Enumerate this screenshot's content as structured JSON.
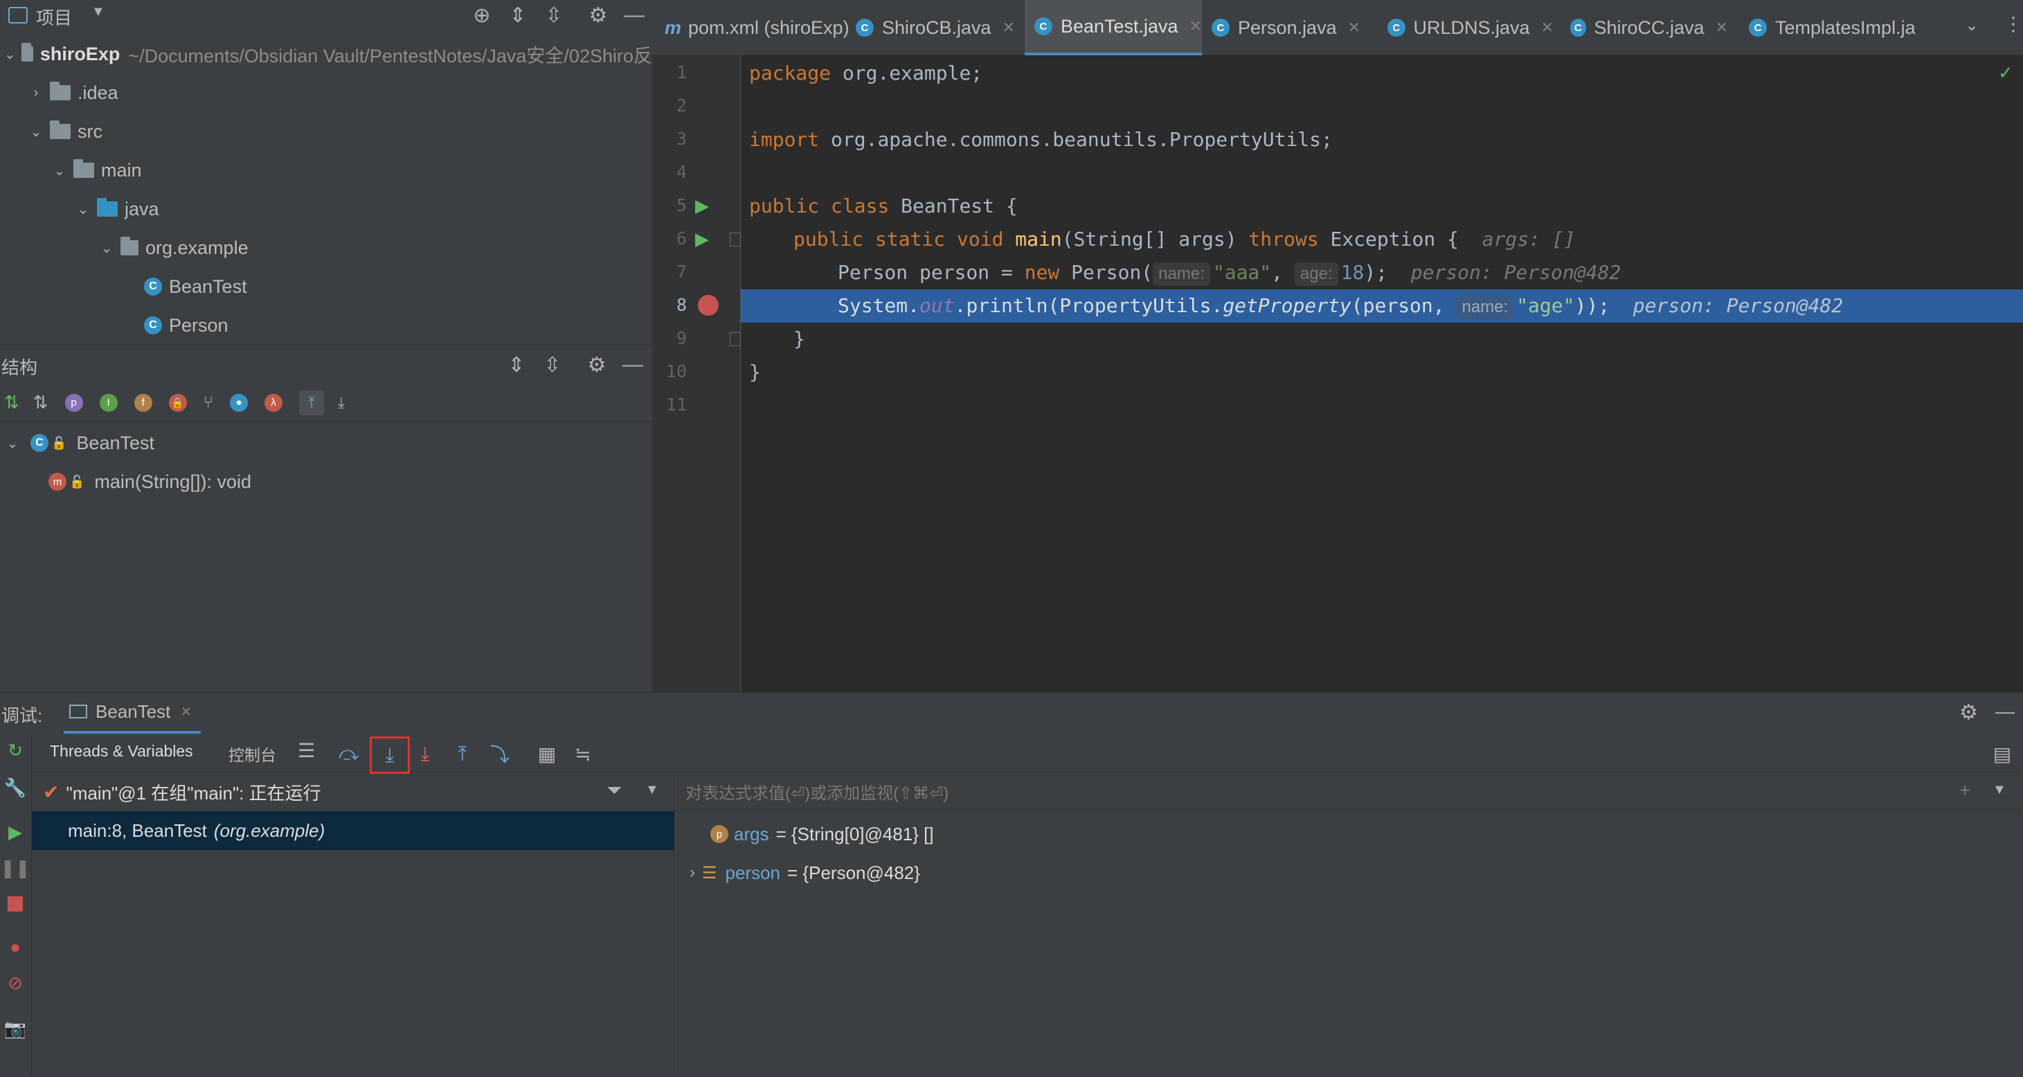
{
  "project": {
    "title": "项目",
    "root_name": "shiroExp",
    "root_path": "~/Documents/Obsidian Vault/PentestNotes/Java安全/02Shiro反",
    "tree": [
      {
        "label": ".idea",
        "type": "folder"
      },
      {
        "label": "src",
        "type": "folder"
      },
      {
        "label": "main",
        "type": "folder"
      },
      {
        "label": "java",
        "type": "folder-blue"
      },
      {
        "label": "org.example",
        "type": "package"
      },
      {
        "label": "BeanTest",
        "type": "class"
      },
      {
        "label": "Person",
        "type": "class"
      }
    ]
  },
  "structure": {
    "title": "结构",
    "class_name": "BeanTest",
    "method": "main(String[]): void"
  },
  "tabs": [
    {
      "label": "pom.xml (shiroExp)",
      "icon": "m"
    },
    {
      "label": "ShiroCB.java",
      "icon": "c"
    },
    {
      "label": "BeanTest.java",
      "icon": "c",
      "active": true
    },
    {
      "label": "Person.java",
      "icon": "c"
    },
    {
      "label": "URLDNS.java",
      "icon": "c"
    },
    {
      "label": "ShiroCC.java",
      "icon": "c"
    },
    {
      "label": "TemplatesImpl.ja",
      "icon": "c"
    }
  ],
  "code": {
    "line_numbers": [
      "1",
      "2",
      "3",
      "4",
      "5",
      "6",
      "7",
      "8",
      "9",
      "10",
      "11"
    ],
    "l1_kw": "package",
    "l1_rest": " org.example;",
    "l3_kw": "import",
    "l3_rest": " org.apache.commons.beanutils.PropertyUtils;",
    "l5_kw": "public class",
    "l5_rest": " BeanTest {",
    "l6_kw1": "public static void",
    "l6_fn": "main",
    "l6_mid": "(String[] args) ",
    "l6_kw2": "throws",
    "l6_rest": " Exception {",
    "l6_hint": "args: []",
    "l7_a": "Person person = ",
    "l7_kw": "new",
    "l7_b": " Person(",
    "l7_hint1": "name:",
    "l7_str": "\"aaa\"",
    "l7_c": ", ",
    "l7_hint2": "age:",
    "l7_num": "18",
    "l7_d": ");",
    "l7_dbg": "person: Person@482",
    "l8_a": "System.",
    "l8_out": "out",
    "l8_b": ".println(PropertyUtils.",
    "l8_fn": "getProperty",
    "l8_c": "(person, ",
    "l8_hint": "name:",
    "l8_str": "\"age\"",
    "l8_d": "));",
    "l8_dbg": "person: Person@482",
    "l9": "}",
    "l10": "}"
  },
  "debug": {
    "label": "调试:",
    "session_tab": "BeanTest",
    "tab_threads": "Threads & Variables",
    "tab_console": "控制台",
    "thread_status": "\"main\"@1 在组\"main\": 正在运行",
    "frame_loc": "main:8, BeanTest",
    "frame_pkg": "(org.example)",
    "eval_placeholder": "对表达式求值(⏎)或添加监视(⇧⌘⏎)",
    "vars": [
      {
        "name": "args",
        "value": "= {String[0]@481} []"
      },
      {
        "name": "person",
        "value": "= {Person@482}"
      }
    ]
  },
  "colors": {
    "accent": "#4a88c7",
    "highlight_line": "#2d5f9e",
    "step_into_box": "#e03131"
  }
}
